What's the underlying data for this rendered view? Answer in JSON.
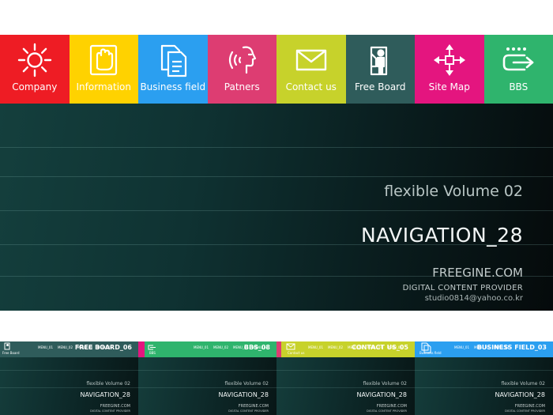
{
  "nav": {
    "items": [
      {
        "label": "Company",
        "icon": "sun-icon",
        "color": "#ee1c24"
      },
      {
        "label": "Information",
        "icon": "hand-icon",
        "color": "#ffd200"
      },
      {
        "label": "Business field",
        "icon": "documents-icon",
        "color": "#2b9ff0"
      },
      {
        "label": "Patners",
        "icon": "speaking-person-icon",
        "color": "#dd3d72"
      },
      {
        "label": "Contact us",
        "icon": "envelope-icon",
        "color": "#c7d22b"
      },
      {
        "label": "Free Board",
        "icon": "board-person-icon",
        "color": "#2f5c5b"
      },
      {
        "label": "Site Map",
        "icon": "arrows-cross-icon",
        "color": "#e4157f"
      },
      {
        "label": "BBS",
        "icon": "bbs-arrow-icon",
        "color": "#2fb46d"
      }
    ]
  },
  "hero": {
    "subtitle": "flexible Volume 02",
    "title": "NAVIGATION_28",
    "brand": "FREEGINE.COM",
    "tagline": "DIGITAL CONTENT PROVIDER",
    "email": "studio0814@yahoo.co.kr"
  },
  "thumbs": [
    {
      "title": "FREE BOARD_06",
      "bar_color": "#2f5c5b",
      "icon_label": "Free Board",
      "menus": [
        "MENU_01",
        "MENU_02",
        "MENU_03",
        "MENU_04"
      ],
      "subtitle": "flexible Volume 02",
      "name": "NAVIGATION_28",
      "brand": "FREEGINE.COM",
      "tagline": "DIGITAL CONTENT PROVIDER"
    },
    {
      "title": "BBS_08",
      "bar_color": "#2fb46d",
      "icon_label": "BBS",
      "menus": [
        "MENU_01",
        "MENU_02",
        "MENU_03",
        "MENU_04"
      ],
      "subtitle": "flexible Volume 02",
      "name": "NAVIGATION_28",
      "brand": "FREEGINE.COM",
      "tagline": "DIGITAL CONTENT PROVIDER"
    },
    {
      "title": "CONTACT US_05",
      "bar_color": "#c7d22b",
      "icon_label": "Contact us",
      "menus": [
        "MENU_01",
        "MENU_02",
        "MENU_03",
        "MENU_04",
        "MENU_05"
      ],
      "subtitle": "flexible Volume 02",
      "name": "NAVIGATION_28",
      "brand": "FREEGINE.COM",
      "tagline": "DIGITAL CONTENT PROVIDER"
    },
    {
      "title": "BUSINESS FIELD_03",
      "bar_color": "#2b9ff0",
      "icon_label": "Business field",
      "menus": [
        "MENU_01",
        "MENU_02",
        "MENU_03"
      ],
      "subtitle": "flexible Volume 02",
      "name": "NAVIGATION_28",
      "brand": "FREEGINE.COM",
      "tagline": "DIGITAL CONTENT PROVIDER"
    }
  ]
}
